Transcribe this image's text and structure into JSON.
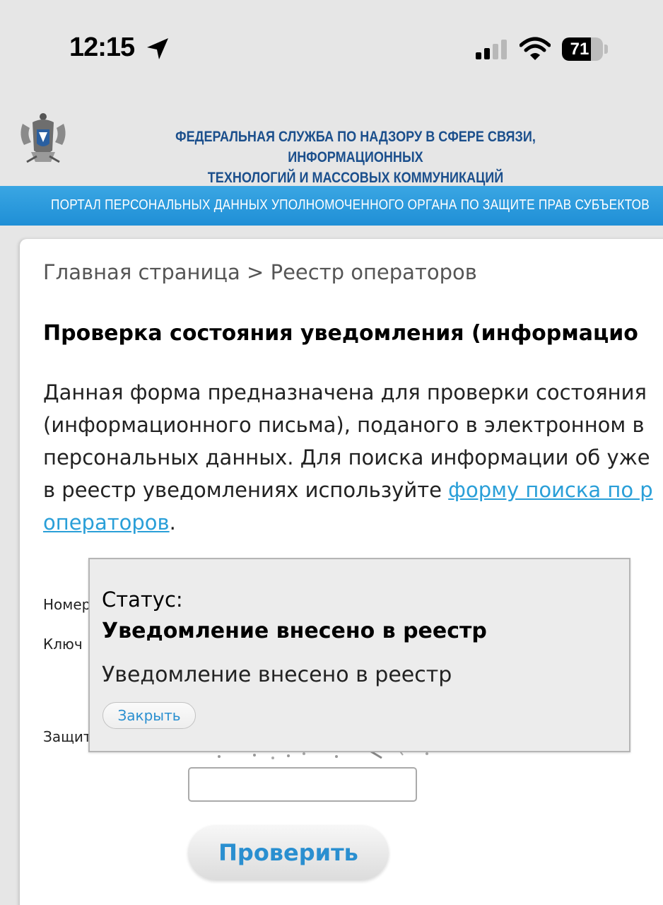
{
  "status_bar": {
    "time": "12:15",
    "battery": "71",
    "battery_level": 0.71,
    "icons": [
      "location-arrow-icon",
      "cellular-signal-icon",
      "wifi-icon",
      "battery-icon"
    ]
  },
  "header": {
    "agency_title_line1": "ФЕДЕРАЛЬНАЯ СЛУЖБА ПО НАДЗОРУ В СФЕРЕ СВЯЗИ, ИНФОРМАЦИОННЫХ",
    "agency_title_line2": "ТЕХНОЛОГИЙ И МАССОВЫХ КОММУНИКАЦИЙ",
    "portal_text": "ПОРТАЛ ПЕРСОНАЛЬНЫХ ДАННЫХ УПОЛНОМОЧЕННОГО ОРГАНА ПО ЗАЩИТЕ ПРАВ СУБЪЕКТОВ",
    "emblem_icon": "double-headed-eagle-emblem-icon"
  },
  "breadcrumb": {
    "home": "Главная страница",
    "separator": ">",
    "current": "Реестр операторов"
  },
  "page_title": "Проверка состояния уведомления (информацио",
  "description": {
    "line1": "Данная форма предназначена для проверки состояния",
    "line2": "(информационного письма), поданого в электронном в",
    "line3": "персональных данных. Для поиска информации об уже",
    "line4_text": "в реестр уведомлениях используйте ",
    "link_part1": "форму поиска по р",
    "link_part2": "операторов",
    "end_period": "."
  },
  "form": {
    "number_label": "Номер",
    "key_label": "Ключ",
    "protection_label": "Защит",
    "code_value": "",
    "submit_label": "Проверить"
  },
  "popup": {
    "label": "Статус:",
    "status": "Уведомление внесено в реестр",
    "message": "Уведомление внесено в реестр",
    "close_label": "Закрыть"
  },
  "colors": {
    "header_title": "#1b4f8c",
    "portal_bar": "#2196dc",
    "link": "#2a9fd8",
    "button_text": "#2a8fd0"
  }
}
